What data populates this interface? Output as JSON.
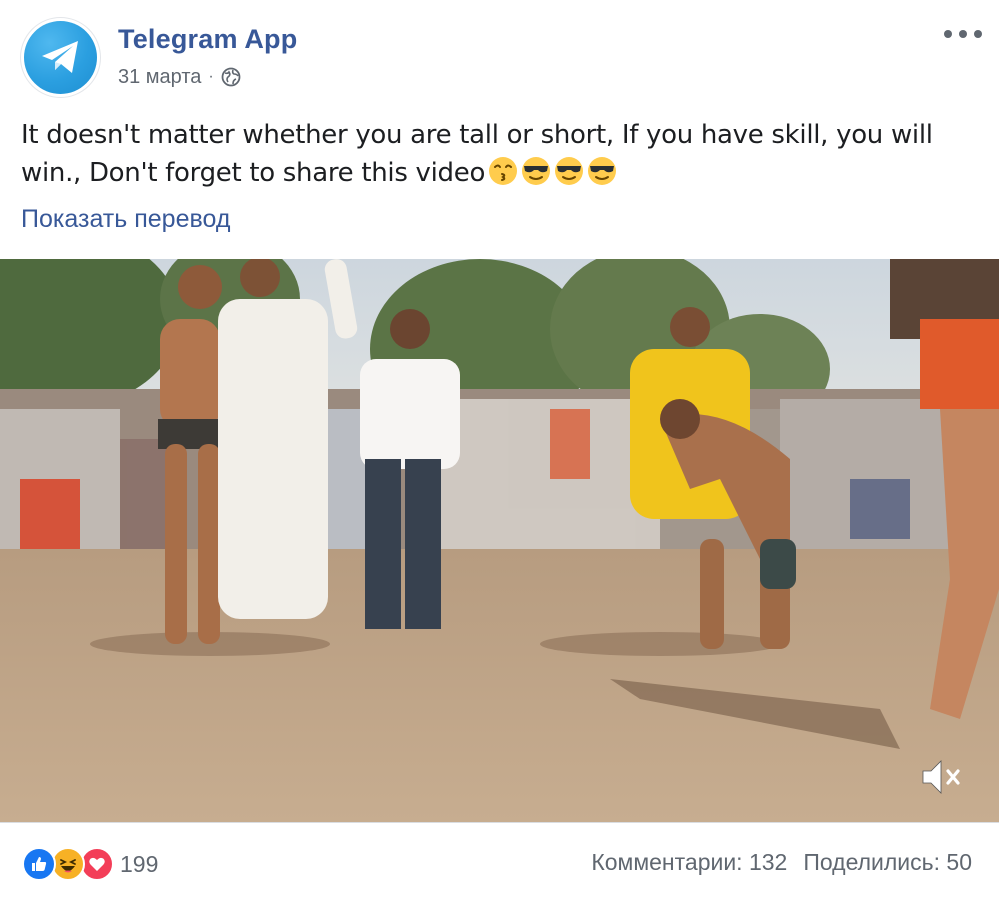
{
  "post": {
    "page_name": "Telegram App",
    "date": "31 марта",
    "separator": "·",
    "privacy_icon": "globe-icon",
    "avatar_icon": "telegram-paper-plane-icon",
    "more_icon": "more-horizontal-icon",
    "text": "It doesn't matter whether you are tall or short, If you have skill, you will win., Don't forget to share this video",
    "emojis": [
      "kissing-face-emoji",
      "sunglasses-face-emoji",
      "sunglasses-face-emoji",
      "sunglasses-face-emoji"
    ],
    "translate_link": "Показать перевод"
  },
  "video": {
    "mute_icon": "speaker-muted-icon"
  },
  "footer": {
    "reaction_icons": [
      "like-icon",
      "haha-icon",
      "love-icon"
    ],
    "reaction_count": "199",
    "comments": "Комментарии: 132",
    "shares": "Поделились: 50"
  },
  "colors": {
    "link": "#385898",
    "secondary_text": "#606770",
    "like": "#1877f2",
    "haha": "#f7b125",
    "love": "#f33e58",
    "telegram": "#2b9fe0"
  }
}
